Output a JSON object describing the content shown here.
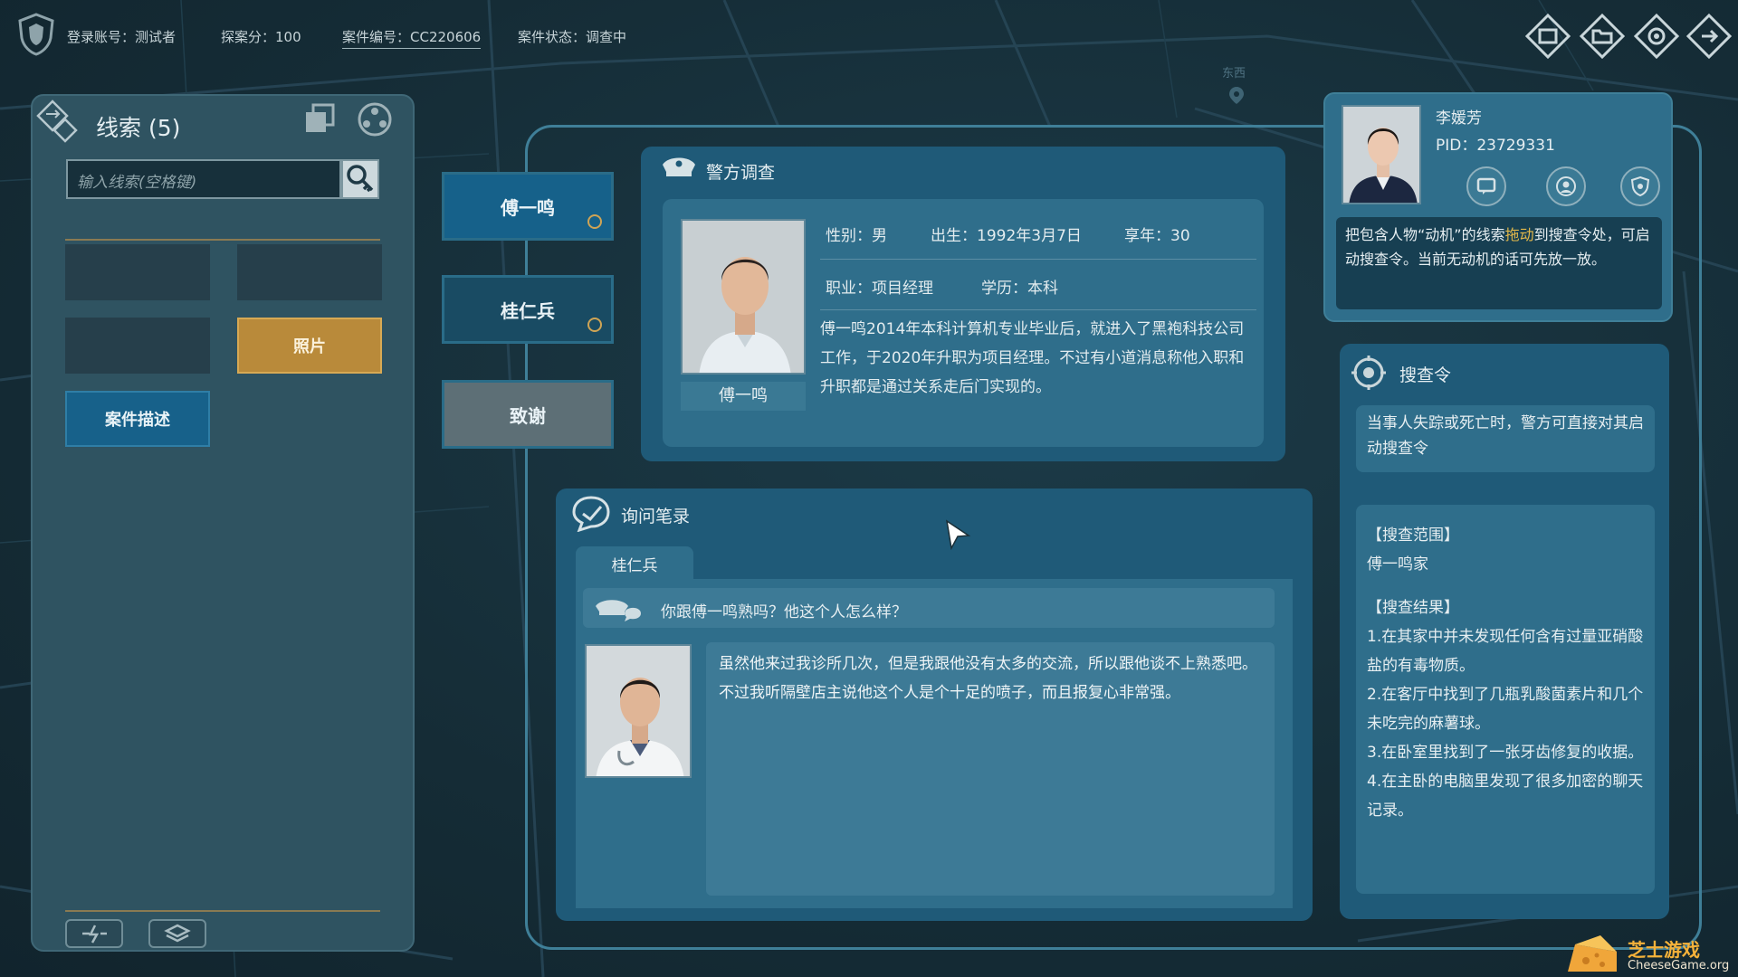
{
  "topbar": {
    "account_label": "登录账号：",
    "account_value": "测试者",
    "score_label": "探案分：",
    "score_value": "100",
    "case_id_label": "案件编号：",
    "case_id_value": "CC220606",
    "status_label": "案件状态：",
    "status_value": "调查中"
  },
  "map_label": "东西",
  "clues": {
    "title": "线索 (5)",
    "search_placeholder": "输入线索(空格键)",
    "photo_label": "照片",
    "case_desc_label": "案件描述"
  },
  "persons": [
    {
      "name": "傅一鸣"
    },
    {
      "name": "桂仁兵"
    },
    {
      "name": "致谢"
    }
  ],
  "police": {
    "title": "警方调查",
    "name": "傅一鸣",
    "gender": "性别：男",
    "birth": "出生：1992年3月7日",
    "age": "享年：30",
    "job": "职业：项目经理",
    "education": "学历：本科",
    "bio": "傅一鸣2014年本科计算机专业毕业后，就进入了黑袍科技公司工作，于2020年升职为项目经理。不过有小道消息称他入职和升职都是通过关系走后门实现的。"
  },
  "record": {
    "title": "询问笔录",
    "tab": "桂仁兵",
    "question": "你跟傅一鸣熟吗？他这个人怎么样？",
    "answer": "虽然他来过我诊所几次，但是我跟他没有太多的交流，所以跟他谈不上熟悉吧。不过我听隔壁店主说他这个人是个十足的喷子，而且报复心非常强。"
  },
  "officer": {
    "name": "李媛芳",
    "pid": "PID：23729331",
    "hint_before": "把包含人物“动机”的线索",
    "hint_highlight": "拖动",
    "hint_after": "到搜查令处，可启动搜查令。当前无动机的话可先放一放。"
  },
  "search_order": {
    "title": "搜查令",
    "desc": "当事人失踪或死亡时，警方可直接对其启动搜查令",
    "scope_title": "【搜查范围】",
    "scope_value": "傅一鸣家",
    "result_title": "【搜查结果】",
    "results": [
      "1.在其家中并未发现任何含有过量亚硝酸盐的有毒物质。",
      "2.在客厅中找到了几瓶乳酸菌素片和几个未吃完的麻薯球。",
      "3.在卧室里找到了一张牙齿修复的收据。",
      "4.在主卧的电脑里发现了很多加密的聊天记录。"
    ]
  },
  "watermark": {
    "cn": "芝士游戏",
    "en": "CheeseGame.org"
  },
  "colors": {
    "accent_gold": "#b98a3a",
    "accent_blue": "#17618a",
    "panel": "#1f5a78",
    "highlight": "#e3b84a"
  }
}
